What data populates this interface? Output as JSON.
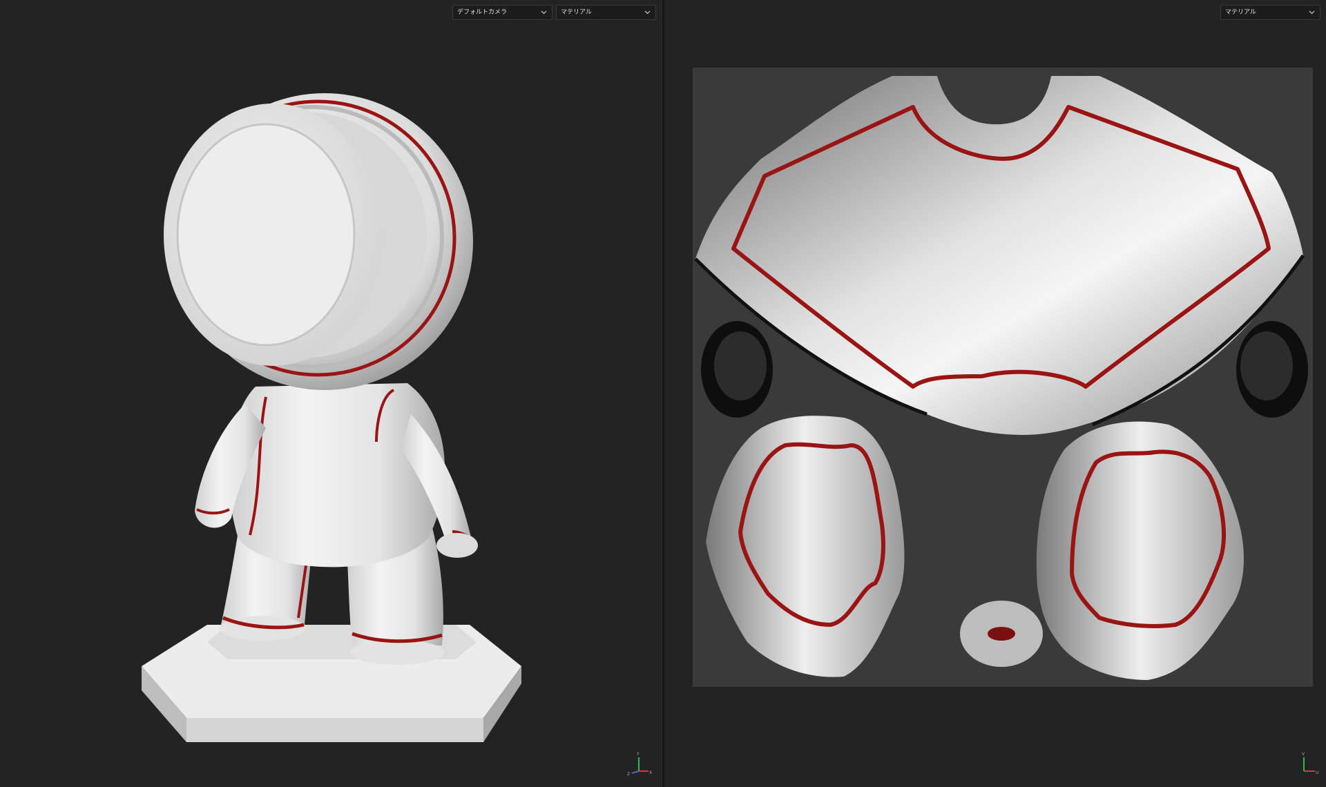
{
  "viewport_3d": {
    "camera_dropdown": {
      "value": "デフォルトカメラ"
    },
    "material_dropdown": {
      "value": "マテリアル"
    },
    "axis": {
      "y": "Y",
      "x": "X",
      "z": "Z"
    }
  },
  "viewport_uv": {
    "material_dropdown": {
      "value": "マテリアル"
    },
    "axis": {
      "v": "V",
      "u": "U"
    }
  },
  "colors": {
    "background": "#232323",
    "uv_tile": "#3a3a3a",
    "model_white": "#e6e6e6",
    "trim_red": "#9a1414",
    "axis_green": "#2bbf4a",
    "axis_red": "#d23b3b",
    "axis_blue": "#3b6bd2"
  }
}
